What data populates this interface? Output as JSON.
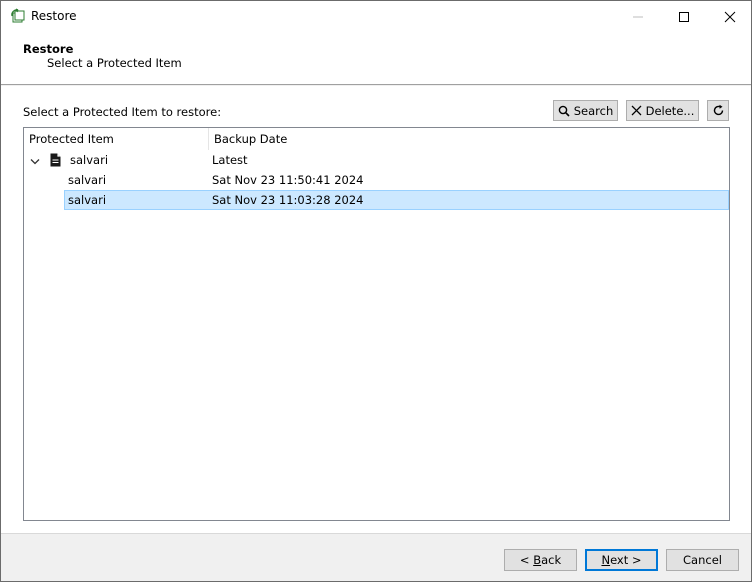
{
  "window": {
    "title": "Restore",
    "app_icon": "restore-app-icon",
    "controls": [
      "minimize-icon",
      "maximize-icon",
      "close-icon"
    ]
  },
  "header": {
    "title": "Restore",
    "subtitle": "Select a Protected Item"
  },
  "main": {
    "prompt": "Select a Protected Item to restore:",
    "search_label": "Search",
    "delete_label": "Delete...",
    "refresh_icon": "refresh-icon",
    "columns": [
      "Protected Item",
      "Backup Date"
    ],
    "tree": {
      "root": {
        "name": "salvari",
        "date": "Latest",
        "expanded": true,
        "icon": "document-icon"
      },
      "children": [
        {
          "name": "salvari",
          "date": "Sat Nov 23 11:50:41 2024",
          "selected": false
        },
        {
          "name": "salvari",
          "date": "Sat Nov 23 11:03:28 2024",
          "selected": true
        }
      ]
    }
  },
  "footer": {
    "back_prefix": "< ",
    "back_key": "B",
    "back_rest": "ack",
    "next_key": "N",
    "next_rest": "ext >",
    "cancel_label": "Cancel"
  },
  "colors": {
    "selection_bg": "#cce8ff",
    "selection_border": "#99d1ff",
    "default_button_border": "#0078d7"
  }
}
